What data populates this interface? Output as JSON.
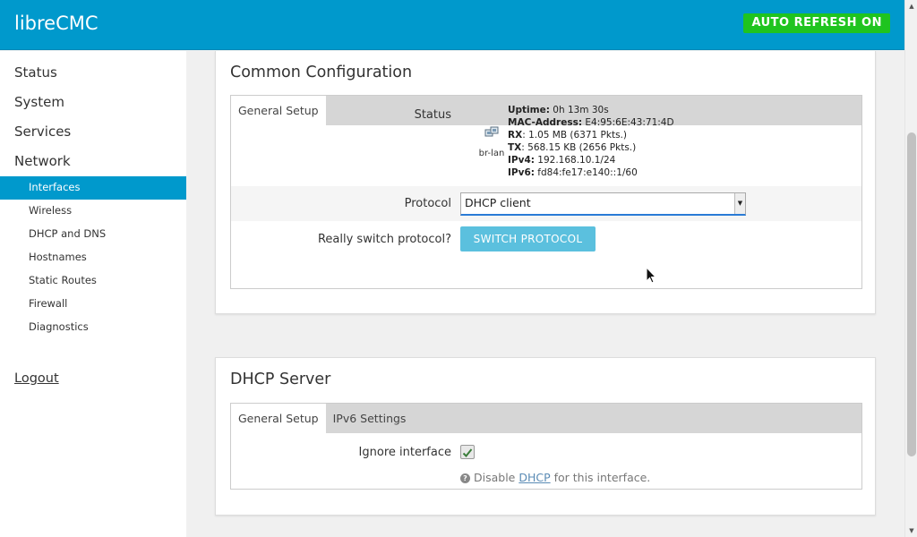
{
  "header": {
    "brand": "libreCMC",
    "auto_refresh": "AUTO REFRESH ON"
  },
  "sidebar": {
    "top_items": [
      "Status",
      "System",
      "Services",
      "Network"
    ],
    "sub_items": [
      "Interfaces",
      "Wireless",
      "DHCP and DNS",
      "Hostnames",
      "Static Routes",
      "Firewall",
      "Diagnostics"
    ],
    "active_sub": "Interfaces",
    "logout": "Logout"
  },
  "common": {
    "title": "Common Configuration",
    "tab": "General Setup",
    "status_label": "Status",
    "iface_label": "br-lan",
    "stats": {
      "uptime_key": "Uptime:",
      "uptime": "0h 13m 30s",
      "mac_key": "MAC-Address:",
      "mac": "E4:95:6E:43:71:4D",
      "rx_key": "RX",
      "rx": ": 1.05 MB (6371 Pkts.)",
      "tx_key": "TX",
      "tx": ": 568.15 KB (2656 Pkts.)",
      "ipv4_key": "IPv4:",
      "ipv4": "192.168.10.1/24",
      "ipv6_key": "IPv6:",
      "ipv6": "fd84:fe17:e140::1/60"
    },
    "protocol_label": "Protocol",
    "protocol_value": "DHCP client",
    "switch_label": "Really switch protocol?",
    "switch_button": "SWITCH PROTOCOL"
  },
  "dhcp": {
    "title": "DHCP Server",
    "tabs": [
      "General Setup",
      "IPv6 Settings"
    ],
    "ignore_label": "Ignore interface",
    "ignore_checked": true,
    "help_prefix": "Disable ",
    "help_link": "DHCP",
    "help_suffix": " for this interface."
  },
  "colors": {
    "header": "#0099cc",
    "active": "#0099cc",
    "badge": "#1fc41f",
    "button": "#5bc0de"
  }
}
